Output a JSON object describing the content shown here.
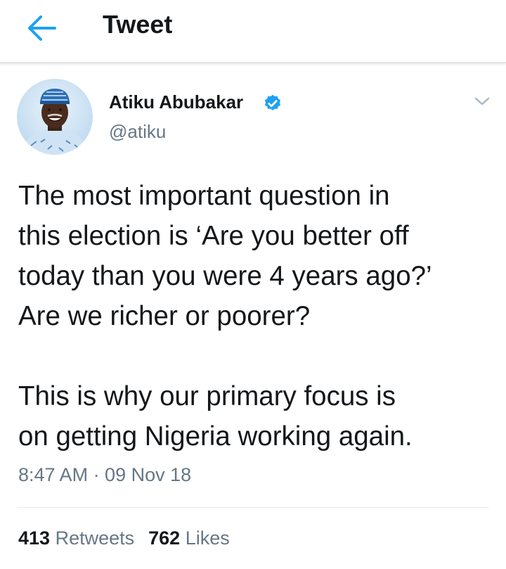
{
  "header": {
    "title": "Tweet",
    "back_icon": "arrow-left-icon",
    "accent_color": "#1da1f2"
  },
  "tweet": {
    "author": {
      "name": "Atiku Abubakar",
      "handle": "@atiku",
      "verified": true,
      "verified_color": "#1da1f2"
    },
    "text_lines": [
      "The most important question in",
      "this election is ‘Are you better off",
      "today than you were 4 years ago?’",
      "Are we richer or poorer?",
      "",
      "This is why our primary focus is",
      "on getting Nigeria working again."
    ],
    "timestamp": "8:47 AM · 09 Nov 18"
  },
  "stats": {
    "retweets_count": "413",
    "retweets_label": "Retweets",
    "likes_count": "762",
    "likes_label": "Likes"
  }
}
